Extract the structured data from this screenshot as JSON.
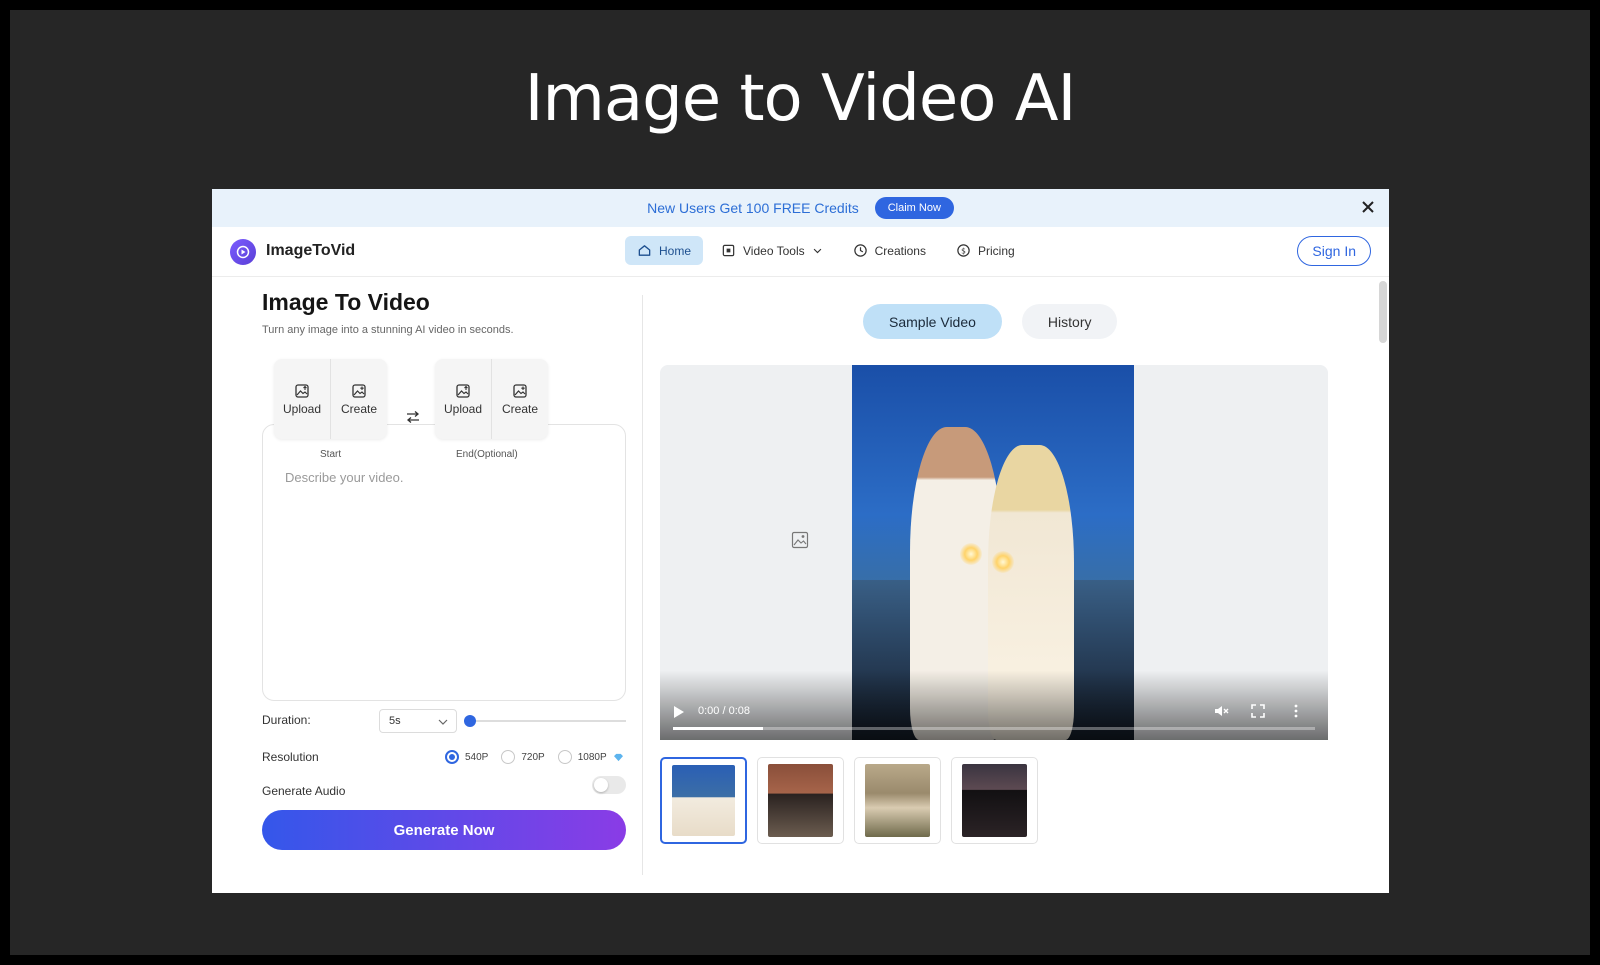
{
  "slide": {
    "title": "Image to Video AI"
  },
  "promo": {
    "text": "New Users Get 100 FREE Credits",
    "cta": "Claim Now"
  },
  "nav": {
    "logo": "ImageToVid",
    "items": [
      {
        "label": "Home",
        "icon": "home-icon",
        "active": true
      },
      {
        "label": "Video Tools",
        "icon": "video-tools-icon"
      },
      {
        "label": "Creations",
        "icon": "clock-icon"
      },
      {
        "label": "Pricing",
        "icon": "pricing-icon"
      }
    ],
    "signin": "Sign In"
  },
  "panel": {
    "title": "Image To Video",
    "subtitle": "Turn any image into a stunning AI video in seconds.",
    "start": {
      "upload": "Upload",
      "create": "Create",
      "caption": "Start"
    },
    "end": {
      "upload": "Upload",
      "create": "Create",
      "caption": "End(Optional)"
    },
    "prompt_placeholder": "Describe your video.",
    "duration_label": "Duration:",
    "duration_value": "5s",
    "duration_slider_level": 0,
    "resolution_label": "Resolution",
    "resolutions": [
      "540P",
      "720P",
      "1080P"
    ],
    "selected_resolution": "540P",
    "audio_label": "Generate Audio",
    "audio_on": false,
    "generate": "Generate Now"
  },
  "preview": {
    "tabs": [
      "Sample Video",
      "History"
    ],
    "active_tab": "Sample Video",
    "time": "0:00 / 0:08",
    "progress_fraction": 0.14,
    "thumbnails": [
      "beach-couple",
      "city-woman",
      "hillside-woman",
      "night-street-woman"
    ],
    "selected_thumbnail": 0
  },
  "colors": {
    "accent": "#2f66e0",
    "gradient_start": "#3457ea",
    "gradient_end": "#8a3ce6",
    "active_nav": "#cfe6f8"
  }
}
